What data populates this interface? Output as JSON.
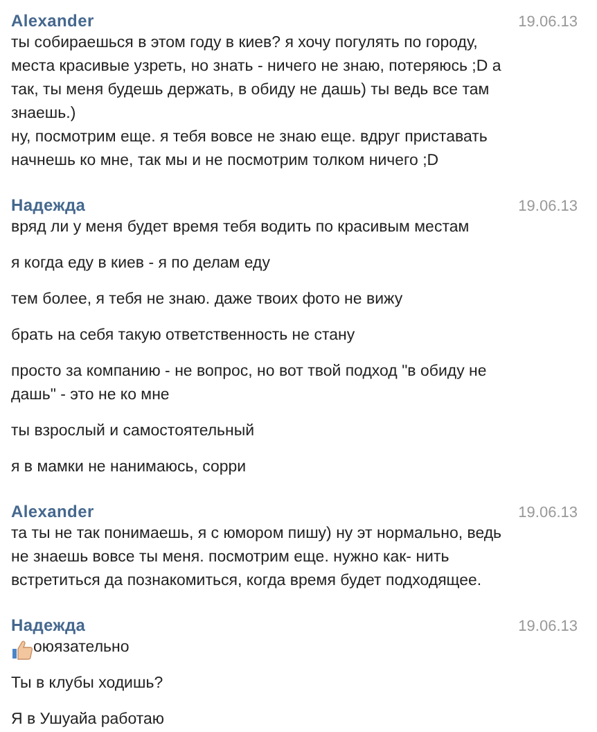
{
  "conversation": [
    {
      "author": "Alexander",
      "date": "19.06.13",
      "messages": [
        {
          "kind": "plain",
          "text": "ты собираешься в этом году в киев? я хочу погулять по городу,\nместа красивые узреть, но знать - ничего не знаю, потеряюсь ;D а\nтак, ты меня будешь держать, в обиду не дашь) ты ведь все там\nзнаешь.)\nну, посмотрим еще. я тебя вовсе не знаю еще. вдруг приставать\nначнешь ко мне, так мы и не посмотрим толком ничего ;D"
        }
      ]
    },
    {
      "author": "Надежда",
      "date": "19.06.13",
      "messages": [
        {
          "kind": "plain",
          "text": "вряд ли у меня будет время тебя водить по красивым местам"
        },
        {
          "kind": "plain",
          "text": "я когда еду в киев - я по делам еду"
        },
        {
          "kind": "plain",
          "text": "тем более, я тебя не знаю. даже твоих фото не вижу"
        },
        {
          "kind": "plain",
          "text": "брать на себя такую ответственность не стану"
        },
        {
          "kind": "plain",
          "text": "просто за компанию - не вопрос, но вот твой подход \"в обиду не\nдашь\" - это не ко мне"
        },
        {
          "kind": "plain",
          "text": "ты взрослый и самостоятельный"
        },
        {
          "kind": "plain",
          "text": "я в мамки не нанимаюсь, сорри"
        }
      ]
    },
    {
      "author": "Alexander",
      "date": "19.06.13",
      "messages": [
        {
          "kind": "plain",
          "text": "та ты не так понимаешь, я с юмором пишу) ну эт нормально, ведь\nне знаешь вовсе ты меня. посмотрим еще. нужно как- нить\nвстретиться да познакомиться, когда время будет подходящее."
        }
      ]
    },
    {
      "author": "Надежда",
      "date": "19.06.13",
      "messages": [
        {
          "kind": "thumbs_up",
          "text": "оюязательно"
        },
        {
          "kind": "plain",
          "text": "Ты в клубы ходишь?"
        },
        {
          "kind": "plain",
          "text": "Я в Ушуайа работаю"
        }
      ]
    }
  ]
}
